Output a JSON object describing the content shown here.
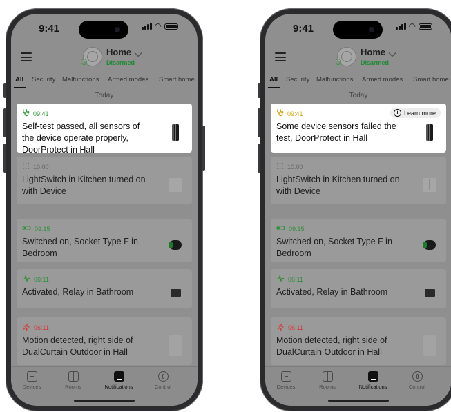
{
  "colors": {
    "ok_green": "#2e9a3b",
    "warn_yellow": "#d6a40c",
    "alarm_red": "#d33a3a",
    "relay_green": "#2f8f3a",
    "switch_gray": "#666666",
    "card_highlight": "#ffffff",
    "overlay_gray": "#8f8f8f"
  },
  "screens": [
    {
      "status_time": "9:41",
      "header": {
        "title": "Home",
        "subtitle": "Disarmed",
        "chevron_icon": "chevron-down-icon"
      },
      "tabs": [
        "All",
        "Security",
        "Malfunctions",
        "Armed modes",
        "Smart home"
      ],
      "active_tab": 0,
      "day_label": "Today",
      "events": [
        {
          "time": "09:41",
          "text": "Self-test passed, all sensors of the device operate properly, DoorProtect in Hall",
          "icon": "stethoscope-icon",
          "color": "#2e9a3b",
          "device": "door-sensor",
          "highlight": true
        },
        {
          "time": "10:00",
          "text": "LightSwitch in Kitchen turned on with Device",
          "icon": "keypad-icon",
          "color": "#666666",
          "device": "light-switch",
          "highlight": false
        },
        {
          "time": "09:15",
          "text": "Switched on, Socket Type F in Bedroom",
          "icon": "toggle-icon",
          "color": "#2f8f3a",
          "device": "socket",
          "highlight": false
        },
        {
          "time": "06:11",
          "text": "Activated, Relay in Bathroom",
          "icon": "pulse-icon",
          "color": "#2f8f3a",
          "device": "relay",
          "highlight": false
        },
        {
          "time": "06:11",
          "text": "Motion detected, right side of DualCurtain Outdoor in Hall",
          "icon": "running-person-icon",
          "color": "#d33a3a",
          "device": "curtain-sensor",
          "highlight": false
        }
      ]
    },
    {
      "status_time": "9:41",
      "header": {
        "title": "Home",
        "subtitle": "Disarmed",
        "chevron_icon": "chevron-down-icon"
      },
      "tabs": [
        "All",
        "Security",
        "Malfunctions",
        "Armed modes",
        "Smart home"
      ],
      "active_tab": 0,
      "day_label": "Today",
      "events": [
        {
          "time": "09:41",
          "text": "Some device sensors failed the test, DoorProtect in Hall",
          "icon": "stethoscope-icon",
          "color": "#d6a40c",
          "device": "door-sensor",
          "highlight": true,
          "action": "Learn more"
        },
        {
          "time": "10:00",
          "text": "LightSwitch in Kitchen turned on with Device",
          "icon": "keypad-icon",
          "color": "#666666",
          "device": "light-switch",
          "highlight": false
        },
        {
          "time": "09:15",
          "text": "Switched on, Socket Type F in Bedroom",
          "icon": "toggle-icon",
          "color": "#2f8f3a",
          "device": "socket",
          "highlight": false
        },
        {
          "time": "06:11",
          "text": "Activated, Relay in Bathroom",
          "icon": "pulse-icon",
          "color": "#2f8f3a",
          "device": "relay",
          "highlight": false
        },
        {
          "time": "06:11",
          "text": "Motion detected, right side of DualCurtain Outdoor in Hall",
          "icon": "running-person-icon",
          "color": "#d33a3a",
          "device": "curtain-sensor",
          "highlight": false
        }
      ]
    }
  ],
  "nav": [
    {
      "label": "Devices",
      "icon": "devices-icon"
    },
    {
      "label": "Rooms",
      "icon": "rooms-icon"
    },
    {
      "label": "Notifications",
      "icon": "notifications-icon",
      "active": true
    },
    {
      "label": "Control",
      "icon": "control-icon"
    }
  ]
}
